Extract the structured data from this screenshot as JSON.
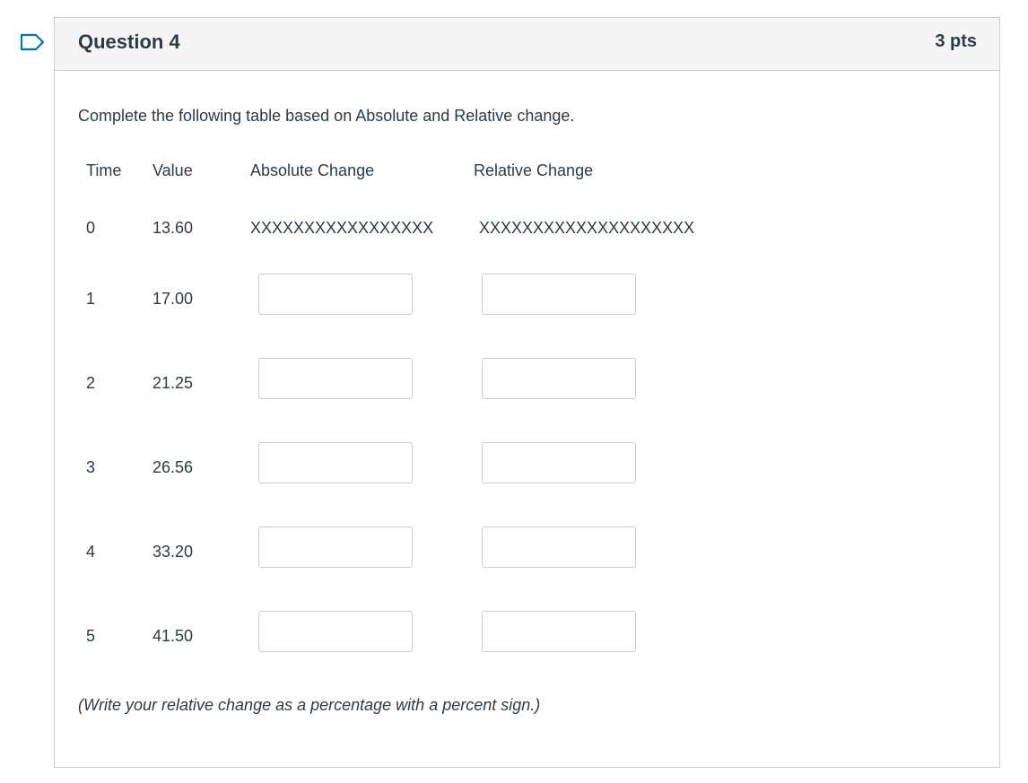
{
  "question": {
    "title": "Question 4",
    "points": "3 pts",
    "prompt": "Complete the following table based on Absolute and Relative change.",
    "note": "(Write your relative change as a percentage with a percent sign.)"
  },
  "table": {
    "headers": {
      "time": "Time",
      "value": "Value",
      "absolute": "Absolute Change",
      "relative": "Relative Change"
    },
    "rows": [
      {
        "time": "0",
        "value": "13.60",
        "absolute": "XXXXXXXXXXXXXXXXX",
        "relative": "XXXXXXXXXXXXXXXXXXXX"
      },
      {
        "time": "1",
        "value": "17.00",
        "absolute": "",
        "relative": ""
      },
      {
        "time": "2",
        "value": "21.25",
        "absolute": "",
        "relative": ""
      },
      {
        "time": "3",
        "value": "26.56",
        "absolute": "",
        "relative": ""
      },
      {
        "time": "4",
        "value": "33.20",
        "absolute": "",
        "relative": ""
      },
      {
        "time": "5",
        "value": "41.50",
        "absolute": "",
        "relative": ""
      }
    ]
  },
  "colors": {
    "accent": "#0374b5",
    "text": "#2d3b45",
    "border": "#c7cdd1",
    "header_bg": "#f5f5f5"
  },
  "icons": {
    "flag": "bookmark-flag-icon"
  }
}
